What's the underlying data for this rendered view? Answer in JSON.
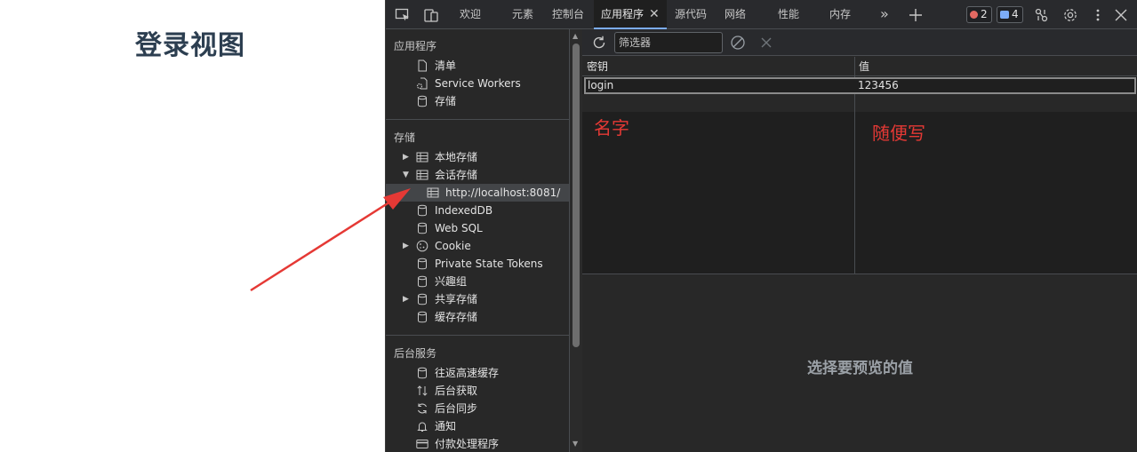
{
  "page": {
    "title": "登录视图"
  },
  "tabs": [
    {
      "label": "欢迎"
    },
    {
      "label": "元素"
    },
    {
      "label": "控制台"
    },
    {
      "label": "应用程序",
      "active": true
    },
    {
      "label": "源代码"
    },
    {
      "label": "网络"
    },
    {
      "label": "性能"
    },
    {
      "label": "内存"
    }
  ],
  "badges": {
    "errors": "2",
    "messages": "4"
  },
  "sidebar": {
    "app_section": "应用程序",
    "app_items": [
      "清单",
      "Service Workers",
      "存储"
    ],
    "storage_section": "存储",
    "storage_items": [
      "本地存储",
      "会话存储",
      "http://localhost:8081/",
      "IndexedDB",
      "Web SQL",
      "Cookie",
      "Private State Tokens",
      "兴趣组",
      "共享存储",
      "缓存存储"
    ],
    "bg_section": "后台服务",
    "bg_items": [
      "往返高速缓存",
      "后台获取",
      "后台同步",
      "通知",
      "付款处理程序"
    ]
  },
  "toolbar": {
    "filter_placeholder": "筛选器"
  },
  "table": {
    "headers": {
      "key": "密钥",
      "value": "值"
    },
    "rows": [
      {
        "key": "login",
        "value": "123456"
      }
    ]
  },
  "annotations": {
    "name": "名字",
    "anything": "随便写"
  },
  "preview": {
    "text": "选择要预览的值"
  },
  "colors": {
    "arrow": "#e53935",
    "annotation": "#e53935",
    "active_tab_underline": "#7cacf8"
  }
}
